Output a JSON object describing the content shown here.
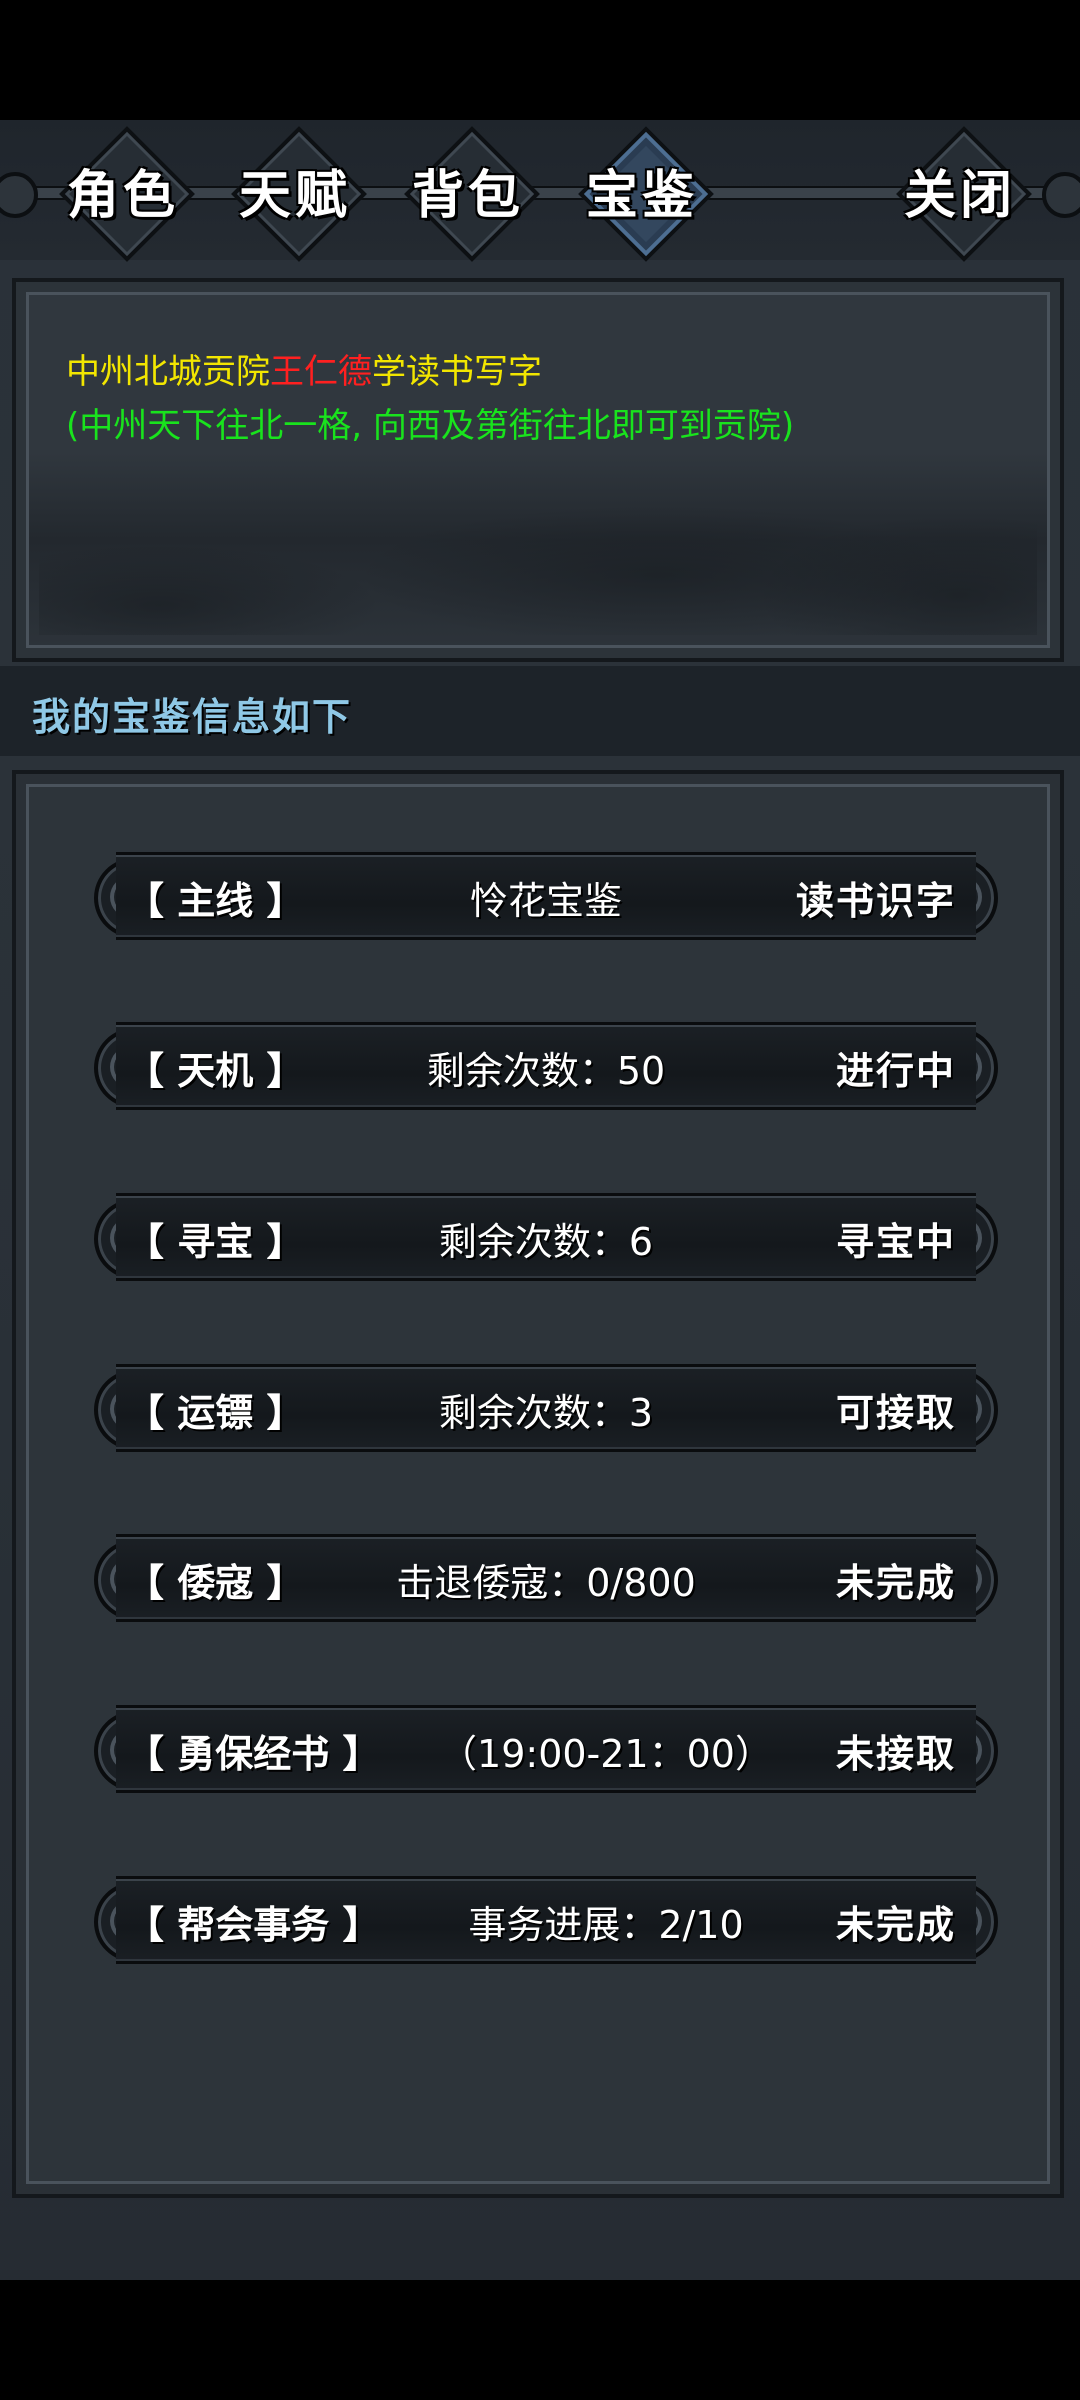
{
  "tabs": [
    {
      "label": "角色",
      "active": false
    },
    {
      "label": "天赋",
      "active": false
    },
    {
      "label": "背包",
      "active": false
    },
    {
      "label": "宝鉴",
      "active": true
    }
  ],
  "close_label": "关闭",
  "notice": {
    "line1_prefix": "中州北城贡院",
    "line1_npc": "王仁德",
    "line1_suffix": "学读书写字",
    "line2": "(中州天下往北一格, 向西及第街往北即可到贡院)"
  },
  "section_title": "我的宝鉴信息如下",
  "quests": [
    {
      "category": "【 主线 】",
      "detail": "怜花宝鉴",
      "status": "读书识字"
    },
    {
      "category": "【 天机 】",
      "detail": "剩余次数：50",
      "status": "进行中"
    },
    {
      "category": "【 寻宝 】",
      "detail": "剩余次数：6",
      "status": "寻宝中"
    },
    {
      "category": "【 运镖 】",
      "detail": "剩余次数：3",
      "status": "可接取"
    },
    {
      "category": "【 倭寇 】",
      "detail": "击退倭寇：0/800",
      "status": "未完成"
    },
    {
      "category": "【 勇保经书 】",
      "detail": "（19:00-21：00）",
      "status": "未接取"
    },
    {
      "category": "【 帮会事务 】",
      "detail": "事务进展：2/10",
      "status": "未完成"
    }
  ],
  "colors": {
    "location_text": "#f2e600",
    "npc_text": "#ff2020",
    "hint_text": "#19e31d",
    "section_title": "#8fc8e6",
    "active_tab": "#4d6e92"
  }
}
